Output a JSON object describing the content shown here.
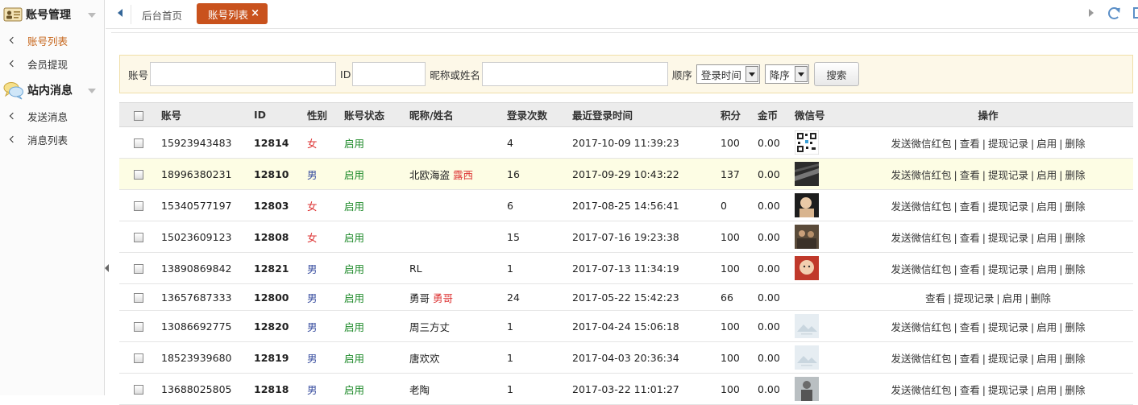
{
  "sidebar": {
    "sections": [
      {
        "title": "账号管理",
        "items": [
          {
            "label": "账号列表",
            "active": true
          },
          {
            "label": "会员提现",
            "active": false
          }
        ]
      },
      {
        "title": "站内消息",
        "items": [
          {
            "label": "发送消息",
            "active": false
          },
          {
            "label": "消息列表",
            "active": false
          }
        ]
      }
    ]
  },
  "tabs": {
    "home": "后台首页",
    "active": "账号列表",
    "close": "×"
  },
  "search": {
    "account_label": "账号",
    "id_label": "ID",
    "nickname_label": "昵称或姓名",
    "order_label": "顺序",
    "order_field": "登录时间",
    "order_dir": "降序",
    "button": "搜索"
  },
  "table": {
    "headers": [
      "账号",
      "ID",
      "性别",
      "账号状态",
      "昵称/姓名",
      "登录次数",
      "最近登录时间",
      "积分",
      "金币",
      "微信号",
      "操作"
    ],
    "rows": [
      {
        "account": "15923943483",
        "id": "12814",
        "gender": "女",
        "status": "启用",
        "nick": "",
        "nick_extra": "",
        "logins": "4",
        "last": "2017-10-09 11:39:23",
        "points": "100",
        "gold": "0.00",
        "avatar": "qr-code",
        "ops": [
          "发送微信红包",
          "查看",
          "提现记录",
          "启用",
          "删除"
        ]
      },
      {
        "account": "18996380231",
        "id": "12810",
        "gender": "男",
        "status": "启用",
        "nick": "北欧海盗",
        "nick_extra": "露西",
        "logins": "16",
        "last": "2017-09-29 10:43:22",
        "points": "137",
        "gold": "0.00",
        "avatar": "dark-photo",
        "ops": [
          "发送微信红包",
          "查看",
          "提现记录",
          "启用",
          "删除"
        ]
      },
      {
        "account": "15340577197",
        "id": "12803",
        "gender": "女",
        "status": "启用",
        "nick": "",
        "nick_extra": "",
        "logins": "6",
        "last": "2017-08-25 14:56:41",
        "points": "0",
        "gold": "0.00",
        "avatar": "child-photo",
        "ops": [
          "发送微信红包",
          "查看",
          "提现记录",
          "启用",
          "删除"
        ]
      },
      {
        "account": "15023609123",
        "id": "12808",
        "gender": "女",
        "status": "启用",
        "nick": "",
        "nick_extra": "",
        "logins": "15",
        "last": "2017-07-16 19:23:38",
        "points": "100",
        "gold": "0.00",
        "avatar": "group-photo",
        "ops": [
          "发送微信红包",
          "查看",
          "提现记录",
          "启用",
          "删除"
        ]
      },
      {
        "account": "13890869842",
        "id": "12821",
        "gender": "男",
        "status": "启用",
        "nick": "RL",
        "nick_extra": "",
        "logins": "1",
        "last": "2017-07-13 11:34:19",
        "points": "100",
        "gold": "0.00",
        "avatar": "baby-photo",
        "ops": [
          "发送微信红包",
          "查看",
          "提现记录",
          "启用",
          "删除"
        ]
      },
      {
        "account": "13657687333",
        "id": "12800",
        "gender": "男",
        "status": "启用",
        "nick": "勇哥",
        "nick_extra": "勇哥",
        "logins": "24",
        "last": "2017-05-22 15:42:23",
        "points": "66",
        "gold": "0.00",
        "avatar": "",
        "ops": [
          "查看",
          "提现记录",
          "启用",
          "删除"
        ]
      },
      {
        "account": "13086692775",
        "id": "12820",
        "gender": "男",
        "status": "启用",
        "nick": "周三方丈",
        "nick_extra": "",
        "logins": "1",
        "last": "2017-04-24 15:06:18",
        "points": "100",
        "gold": "0.00",
        "avatar": "landscape-placeholder",
        "ops": [
          "发送微信红包",
          "查看",
          "提现记录",
          "启用",
          "删除"
        ]
      },
      {
        "account": "18523939680",
        "id": "12819",
        "gender": "男",
        "status": "启用",
        "nick": "唐欢欢",
        "nick_extra": "",
        "logins": "1",
        "last": "2017-04-03 20:36:34",
        "points": "100",
        "gold": "0.00",
        "avatar": "landscape-placeholder",
        "ops": [
          "发送微信红包",
          "查看",
          "提现记录",
          "启用",
          "删除"
        ]
      },
      {
        "account": "13688025805",
        "id": "12818",
        "gender": "男",
        "status": "启用",
        "nick": "老陶",
        "nick_extra": "",
        "logins": "1",
        "last": "2017-03-22 11:01:27",
        "points": "100",
        "gold": "0.00",
        "avatar": "person-photo",
        "ops": [
          "发送微信红包",
          "查看",
          "提现记录",
          "启用",
          "删除"
        ]
      }
    ]
  },
  "colors": {
    "accent": "#c9521d",
    "active_menu": "#c6651a",
    "female": "#dd3333",
    "male": "#3a4fa0",
    "enabled": "#1e8a2a",
    "highlight_row": "#fdfde4",
    "search_bg": "#fdf8e8"
  }
}
